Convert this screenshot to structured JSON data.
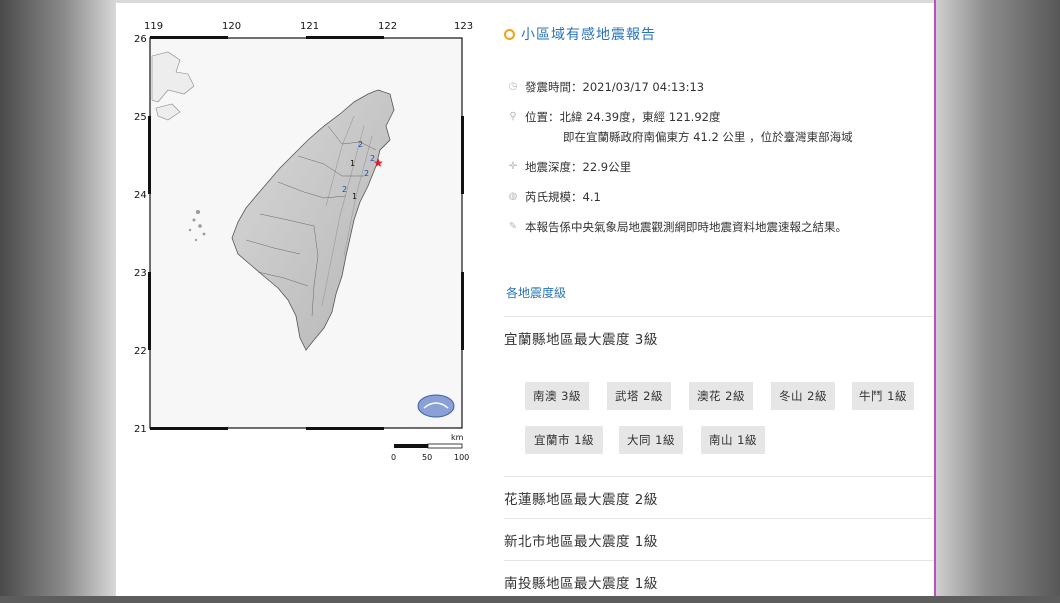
{
  "map": {
    "lon_ticks": [
      "119",
      "120",
      "121",
      "122",
      "123"
    ],
    "lat_ticks": [
      "26",
      "25",
      "24",
      "23",
      "22",
      "21"
    ],
    "scale": {
      "unit": "km",
      "labels": [
        "0",
        "50",
        "100"
      ]
    },
    "station_labels": [
      "1",
      "2",
      "2",
      "2",
      "2",
      "1"
    ],
    "epicenter_color": "#e0202a"
  },
  "report": {
    "title": "小區域有感地震報告",
    "time": "發震時間：2021/03/17 04:13:13",
    "location": "位置：北緯 24.39度，東經 121.92度",
    "location_detail": "即在宜蘭縣政府南偏東方 41.2 公里 ，位於臺灣東部海域",
    "depth": "地震深度：22.9公里",
    "magnitude": "芮氏規模：4.1",
    "note": "本報告係中央氣象局地震觀測網即時地震資料地震速報之結果。",
    "section_title": "各地震度級",
    "counties": [
      "宜蘭縣地區最大震度 3級",
      "花蓮縣地區最大震度 2級",
      "新北市地區最大震度 1級",
      "南投縣地區最大震度 1級"
    ],
    "yilan_stations": [
      "南澳 3級",
      "武塔 2級",
      "澳花 2級",
      "冬山 2級",
      "牛鬥 1級",
      "宜蘭市 1級",
      "大同 1級",
      "南山 1級"
    ]
  },
  "colors": {
    "title_blue": "#2a74b8",
    "accent": "#c04bc7",
    "ring": "#f0a11c"
  }
}
